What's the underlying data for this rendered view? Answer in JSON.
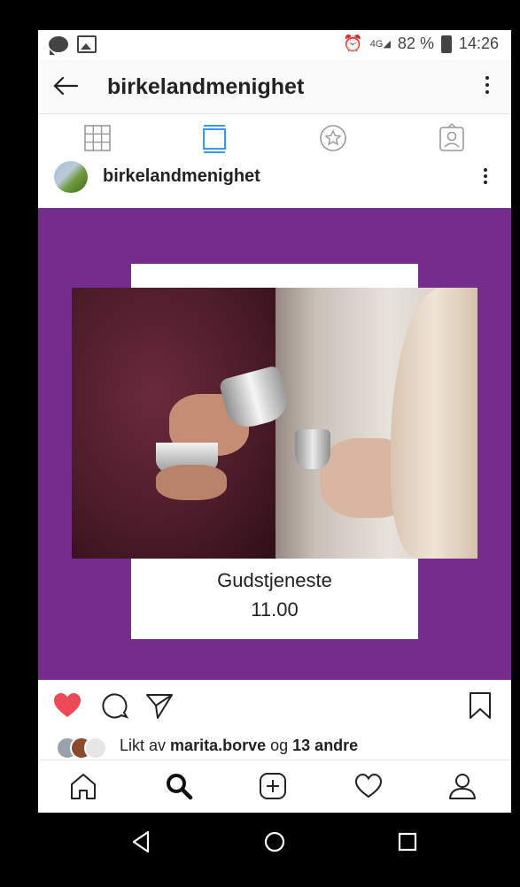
{
  "status_bar": {
    "network_label": "4G",
    "battery_percent": "82 %",
    "time": "14:26"
  },
  "header": {
    "title": "birkelandmenighet"
  },
  "tabs": [
    "grid-icon",
    "feed-icon",
    "star-icon",
    "tagged-icon"
  ],
  "post": {
    "username": "birkelandmenighet",
    "card_title": "Gudstjeneste",
    "card_time": "11.00",
    "liked": true
  },
  "likes": {
    "prefix": "Likt av",
    "user": "marita.borve",
    "connector": "og",
    "others": "13 andre"
  },
  "colors": {
    "post_background": "#742c8d",
    "heart": "#ed4956",
    "active_tab": "#3897f0"
  }
}
